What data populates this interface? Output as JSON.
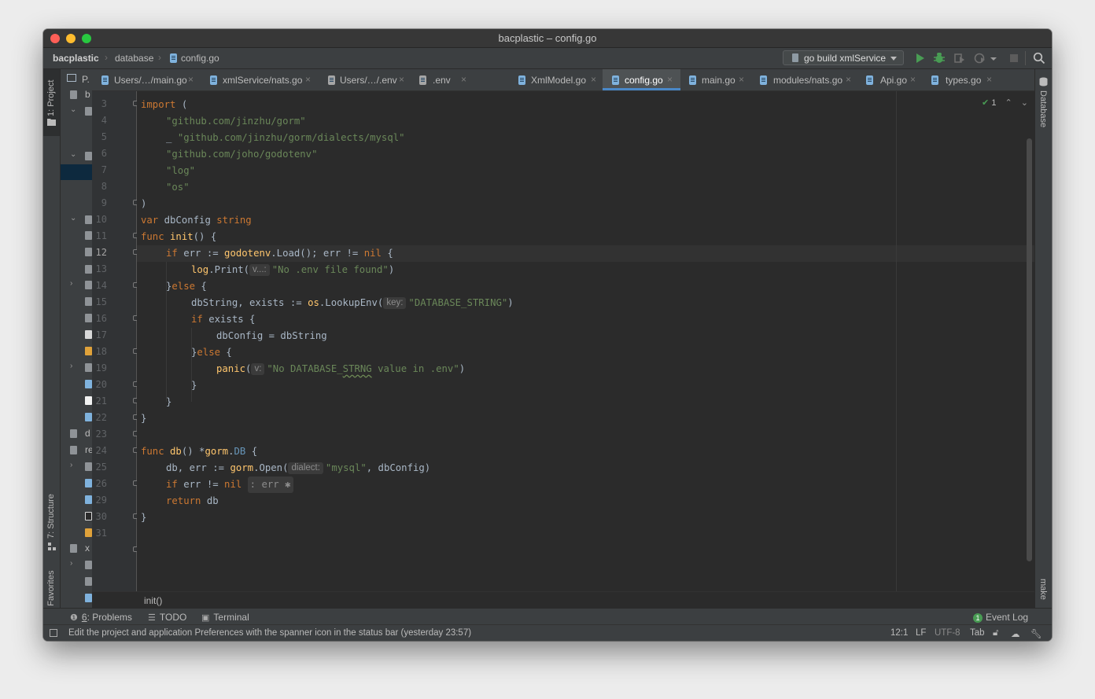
{
  "window": {
    "title": "bacplastic – config.go"
  },
  "navbar": {
    "crumbs": [
      "bacplastic",
      "database",
      "config.go"
    ],
    "run_config": "go build xmlService"
  },
  "left_strip": {
    "project": "1: Project",
    "structure": "7: Structure",
    "favorites": "2: Favorites"
  },
  "right_strip": {
    "database": "Database",
    "make": "make"
  },
  "project_panel": {
    "header": "P.",
    "rows": [
      "b",
      "d",
      "re",
      "x"
    ]
  },
  "tabs": [
    {
      "label": "Users/…/main.go"
    },
    {
      "label": "xmlService/nats.go"
    },
    {
      "label": "Users/…/.env"
    },
    {
      "label": ".env"
    },
    {
      "label": "XmlModel.go"
    },
    {
      "label": "config.go",
      "active": true
    },
    {
      "label": "main.go"
    },
    {
      "label": "modules/nats.go"
    },
    {
      "label": "Api.go"
    },
    {
      "label": "types.go"
    }
  ],
  "editor": {
    "line_numbers": [
      "3",
      "4",
      "5",
      "6",
      "7",
      "8",
      "9",
      "10",
      "11",
      "12",
      "13",
      "14",
      "15",
      "16",
      "17",
      "18",
      "19",
      "20",
      "21",
      "22",
      "23",
      "24",
      "25",
      "26",
      "29",
      "30",
      "31"
    ],
    "current_line": "12",
    "inspection_count": "1",
    "code": {
      "l3_kw": "import",
      "l3_rest": " (",
      "l4": "\"github.com/jinzhu/gorm\"",
      "l5_pre": "_ ",
      "l5": "\"github.com/jinzhu/gorm/dialects/mysql\"",
      "l6": "\"github.com/joho/godotenv\"",
      "l7": "\"log\"",
      "l8": "\"os\"",
      "l9": ")",
      "l10_kw": "var",
      "l10_name": " dbConfig ",
      "l10_type": "string",
      "l11_kw": "func",
      "l11_fn": " init",
      "l11_rest": "() {",
      "l12_kw": "if",
      "l12_a": " err := ",
      "l12_pkg": "godotenv",
      "l12_b": ".Load(); err != ",
      "l12_nil": "nil",
      "l12_c": " {",
      "l13_pkg": "log",
      "l13_a": ".Print(",
      "l13_hint": "v...:",
      "l13_str": "\"No .env file found\"",
      "l13_b": ")",
      "l14_a": "}",
      "l14_kw": "else",
      "l14_b": " {",
      "l15_a": "dbString, exists := ",
      "l15_pkg": "os",
      "l15_b": ".LookupEnv(",
      "l15_hint": "key:",
      "l15_str": "\"DATABASE_STRING\"",
      "l15_c": ")",
      "l16_kw": "if",
      "l16_a": " exists {",
      "l17": "dbConfig = dbString",
      "l18_a": "}",
      "l18_kw": "else",
      "l18_b": " {",
      "l19_fn": "panic",
      "l19_a": "(",
      "l19_hint": "v:",
      "l19_str1": "\"No DATABASE_",
      "l19_sq": "STRNG",
      "l19_str2": " value in .env\"",
      "l19_b": ")",
      "l20": "}",
      "l21": "}",
      "l22": "}",
      "l24_kw": "func",
      "l24_fn": " db",
      "l24_a": "() *",
      "l24_pkg": "gorm",
      "l24_b": ".",
      "l24_type": "DB",
      "l24_c": " {",
      "l25_a": "db, err := ",
      "l25_pkg": "gorm",
      "l25_b": ".Open(",
      "l25_hint": "dialect:",
      "l25_str": "\"mysql\"",
      "l25_c": ", dbConfig)",
      "l26_kw": "if",
      "l26_a": " err != ",
      "l26_nil": "nil",
      "l26_hint": ": err ✱",
      "l29_kw": "return",
      "l29_a": " db",
      "l30": "}"
    },
    "breadcrumb": "init()"
  },
  "tool_windows": {
    "problems_num": "6",
    "problems_label": ": Problems",
    "todo": "TODO",
    "terminal": "Terminal",
    "event_log_count": "1",
    "event_log": "Event Log"
  },
  "status_bar": {
    "message": "Edit the project and application Preferences with the spanner icon in the status bar (yesterday 23:57)",
    "position": "12:1",
    "line_sep": "LF",
    "encoding": "UTF-8",
    "indent": "Tab"
  }
}
